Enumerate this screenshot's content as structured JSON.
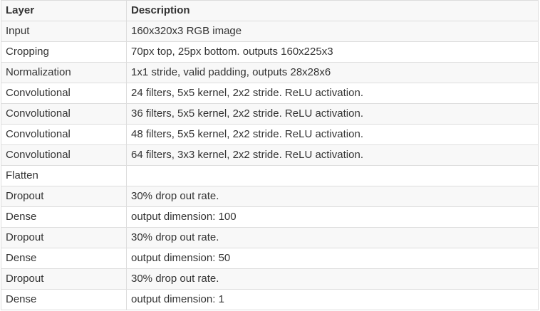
{
  "table": {
    "headers": [
      "Layer",
      "Description"
    ],
    "rows": [
      {
        "layer": "Input",
        "description": "160x320x3 RGB image"
      },
      {
        "layer": "Cropping",
        "description": "70px top, 25px bottom. outputs 160x225x3"
      },
      {
        "layer": "Normalization",
        "description": "1x1 stride, valid padding, outputs 28x28x6"
      },
      {
        "layer": "Convolutional",
        "description": "24 filters, 5x5 kernel, 2x2 stride. ReLU activation."
      },
      {
        "layer": "Convolutional",
        "description": "36 filters, 5x5 kernel, 2x2 stride. ReLU activation."
      },
      {
        "layer": "Convolutional",
        "description": "48 filters, 5x5 kernel, 2x2 stride. ReLU activation."
      },
      {
        "layer": "Convolutional",
        "description": "64 filters, 3x3 kernel, 2x2 stride. ReLU activation."
      },
      {
        "layer": "Flatten",
        "description": ""
      },
      {
        "layer": "Dropout",
        "description": "30% drop out rate."
      },
      {
        "layer": "Dense",
        "description": "output dimension: 100"
      },
      {
        "layer": "Dropout",
        "description": "30% drop out rate."
      },
      {
        "layer": "Dense",
        "description": "output dimension: 50"
      },
      {
        "layer": "Dropout",
        "description": "30% drop out rate."
      },
      {
        "layer": "Dense",
        "description": "output dimension: 1"
      }
    ]
  },
  "colors": {
    "text": "#333333",
    "border": "#dddddd",
    "stripe": "#f8f8f8",
    "background": "#ffffff"
  }
}
